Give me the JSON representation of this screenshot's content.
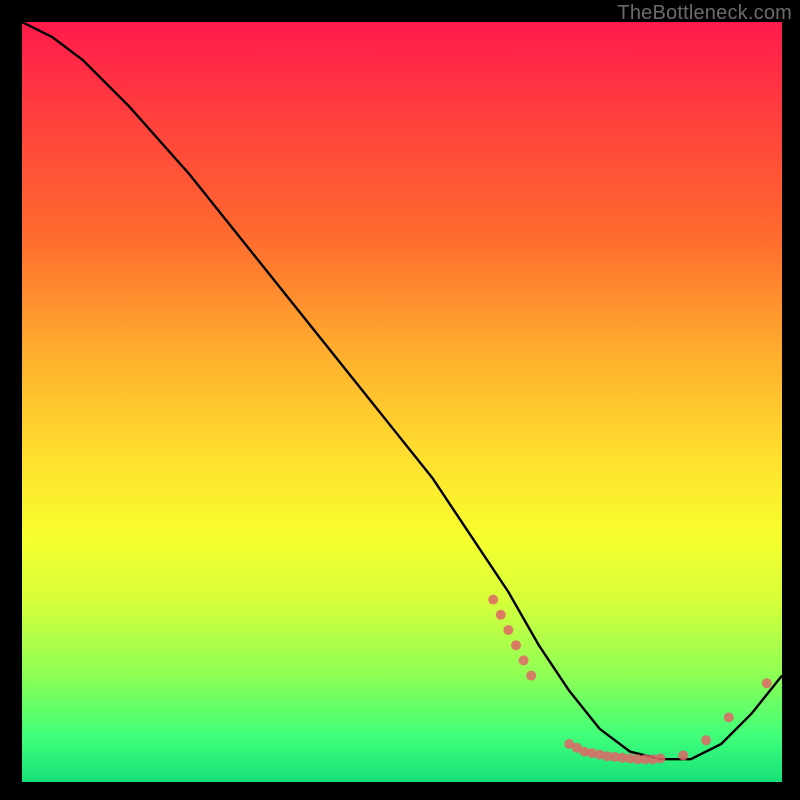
{
  "watermark": "TheBottleneck.com",
  "chart_data": {
    "type": "line",
    "title": "",
    "xlabel": "",
    "ylabel": "",
    "xlim": [
      0,
      100
    ],
    "ylim": [
      0,
      100
    ],
    "grid": false,
    "legend": false,
    "curve": {
      "name": "bottleneck-curve",
      "color": "#000000",
      "x": [
        0,
        4,
        8,
        14,
        22,
        30,
        38,
        46,
        54,
        60,
        64,
        68,
        72,
        76,
        80,
        84,
        88,
        92,
        96,
        100
      ],
      "y": [
        100,
        98,
        95,
        89,
        80,
        70,
        60,
        50,
        40,
        31,
        25,
        18,
        12,
        7,
        4,
        3,
        3,
        5,
        9,
        14
      ]
    },
    "markers": {
      "name": "data-points",
      "color": "#e06666",
      "radius": 5,
      "points": [
        {
          "x": 62,
          "y": 24
        },
        {
          "x": 63,
          "y": 22
        },
        {
          "x": 64,
          "y": 20
        },
        {
          "x": 65,
          "y": 18
        },
        {
          "x": 66,
          "y": 16
        },
        {
          "x": 67,
          "y": 14
        },
        {
          "x": 72,
          "y": 5
        },
        {
          "x": 73,
          "y": 4.5
        },
        {
          "x": 74,
          "y": 4
        },
        {
          "x": 75,
          "y": 3.8
        },
        {
          "x": 76,
          "y": 3.6
        },
        {
          "x": 77,
          "y": 3.4
        },
        {
          "x": 78,
          "y": 3.3
        },
        {
          "x": 79,
          "y": 3.2
        },
        {
          "x": 80,
          "y": 3.1
        },
        {
          "x": 81,
          "y": 3.0
        },
        {
          "x": 82,
          "y": 3.0
        },
        {
          "x": 83,
          "y": 3.0
        },
        {
          "x": 84,
          "y": 3.1
        },
        {
          "x": 87,
          "y": 3.5
        },
        {
          "x": 90,
          "y": 5.5
        },
        {
          "x": 93,
          "y": 8.5
        },
        {
          "x": 98,
          "y": 13
        }
      ]
    }
  }
}
